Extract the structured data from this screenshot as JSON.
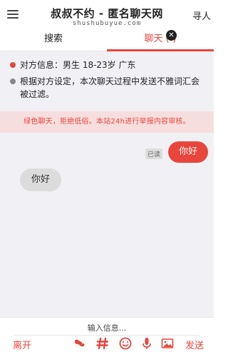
{
  "header": {
    "title": "叔叔不约 - 匿名聊天网",
    "subtitle": "shushubuyue.com",
    "find_label": "寻人",
    "menu_icon": "hamburger-menu-icon"
  },
  "tabs": [
    {
      "label": "搜索",
      "active": false
    },
    {
      "label": "聊天 (-)",
      "active": true
    }
  ],
  "close_badge": "✕",
  "info": {
    "partner_info": "对方信息：男生 18-23岁 广东",
    "filter_notice": "根据对方设定，本次聊天过程中发送不雅词汇会被过滤。"
  },
  "notice": "绿色聊天，拒绝低俗。本站24h进行举报内容审核。",
  "messages": [
    {
      "side": "right",
      "text": "你好",
      "status": "已读"
    },
    {
      "side": "left",
      "text": "你好"
    }
  ],
  "footer": {
    "input_placeholder": "输入信息...",
    "leave_label": "离开",
    "send_label": "发送",
    "tools": [
      "sticker-icon",
      "hashtag-icon",
      "emoji-icon",
      "microphone-icon",
      "image-icon"
    ]
  },
  "colors": {
    "accent": "#e8453c",
    "notice_bg": "#f7dede",
    "chat_bg": "#f1f1f5",
    "bubble_left": "#dcdcdc"
  }
}
